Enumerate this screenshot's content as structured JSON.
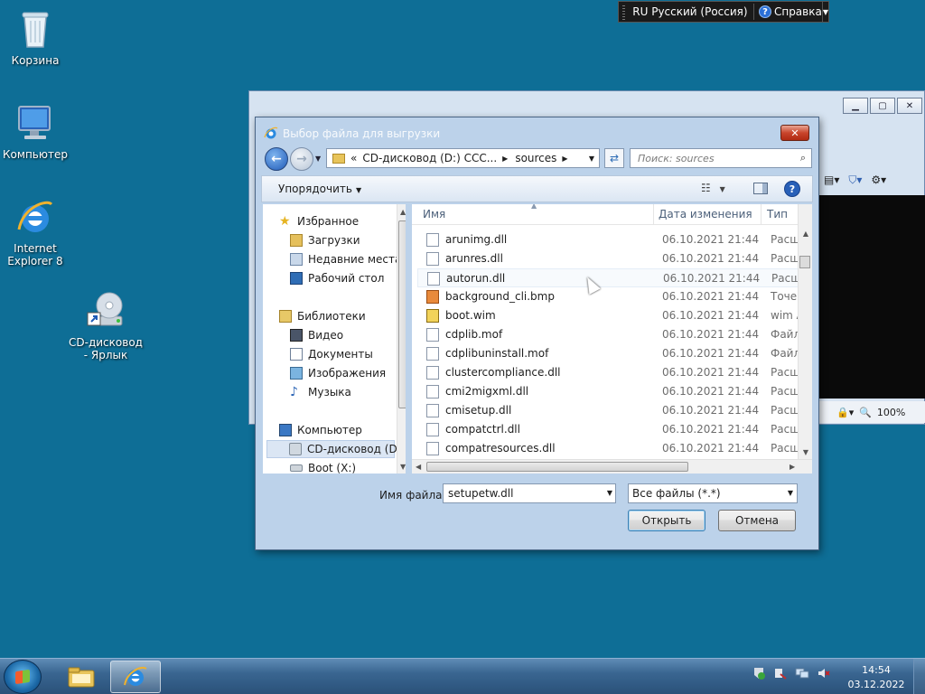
{
  "language_bar": {
    "language": "RU Русский (Россия)",
    "help": "Справка"
  },
  "desktop": {
    "icons": [
      {
        "label": "Корзина"
      },
      {
        "label": "Компьютер"
      },
      {
        "label": "Internet Explorer 8"
      },
      {
        "label": "CD-дисковод - Ярлык"
      }
    ]
  },
  "ie_window": {
    "zoom": "100%"
  },
  "dialog": {
    "title": "Выбор файла для выгрузки",
    "close_label": "✕",
    "address": {
      "prefix": "«",
      "segments": [
        "CD-дисковод (D:) CCC...",
        "sources"
      ]
    },
    "search_placeholder": "Поиск: sources",
    "organize": "Упорядочить",
    "nav": {
      "favorites": "Избранное",
      "downloads": "Загрузки",
      "recent": "Недавние места",
      "desktop": "Рабочий стол",
      "libraries": "Библиотеки",
      "video": "Видео",
      "documents": "Документы",
      "images": "Изображения",
      "music": "Музыка",
      "computer": "Компьютер",
      "cd_drive": "CD-дисковод (D:",
      "boot": "Boot (X:)"
    },
    "columns": {
      "name": "Имя",
      "date": "Дата изменения",
      "type": "Тип"
    },
    "files": [
      {
        "name": "arunimg.dll",
        "date": "06.10.2021 21:44",
        "type": "Расш"
      },
      {
        "name": "arunres.dll",
        "date": "06.10.2021 21:44",
        "type": "Расш"
      },
      {
        "name": "autorun.dll",
        "date": "06.10.2021 21:44",
        "type": "Расш"
      },
      {
        "name": "background_cli.bmp",
        "date": "06.10.2021 21:44",
        "type": "Точеч"
      },
      {
        "name": "boot.wim",
        "date": "06.10.2021 21:44",
        "type": "wim A"
      },
      {
        "name": "cdplib.mof",
        "date": "06.10.2021 21:44",
        "type": "Файл"
      },
      {
        "name": "cdplibuninstall.mof",
        "date": "06.10.2021 21:44",
        "type": "Файл"
      },
      {
        "name": "clustercompliance.dll",
        "date": "06.10.2021 21:44",
        "type": "Расш"
      },
      {
        "name": "cmi2migxml.dll",
        "date": "06.10.2021 21:44",
        "type": "Расш"
      },
      {
        "name": "cmisetup.dll",
        "date": "06.10.2021 21:44",
        "type": "Расш"
      },
      {
        "name": "compatctrl.dll",
        "date": "06.10.2021 21:44",
        "type": "Расш"
      },
      {
        "name": "compatresources.dll",
        "date": "06.10.2021 21:44",
        "type": "Расш"
      }
    ],
    "filename_label": "Имя файла:",
    "filename_value": "setupetw.dll",
    "filetype": "Все файлы (*.*)",
    "open_button": "Открыть",
    "cancel_button": "Отмена"
  },
  "taskbar": {
    "time": "14:54",
    "date": "03.12.2022"
  }
}
